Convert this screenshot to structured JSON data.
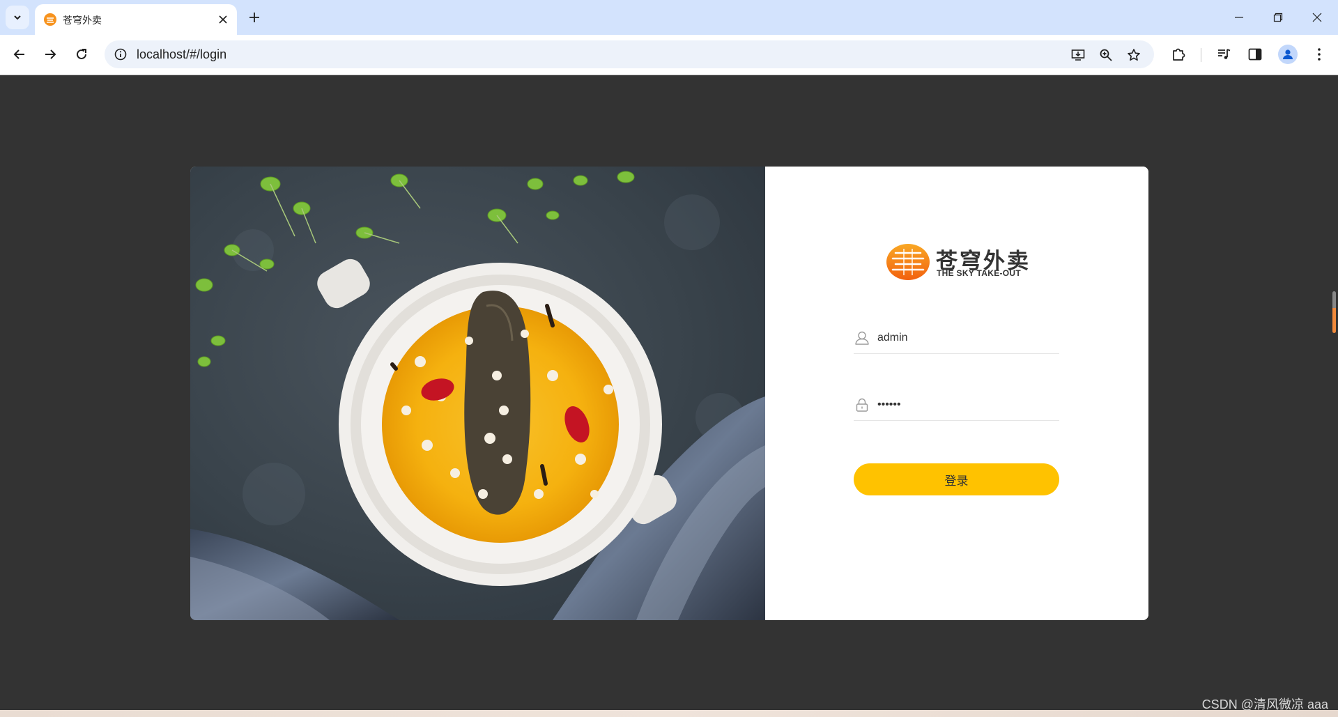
{
  "browser": {
    "tab_title": "苍穹外卖",
    "url": "localhost/#/login"
  },
  "logo": {
    "name_cn": "苍穹外卖",
    "name_en": "THE SKY TAKE-OUT"
  },
  "login_form": {
    "username_value": "admin",
    "password_value": "123456",
    "submit_label": "登录"
  },
  "watermark": "CSDN @清风微凉 aaa",
  "colors": {
    "page_background": "#333333",
    "accent": "#ffc200"
  }
}
